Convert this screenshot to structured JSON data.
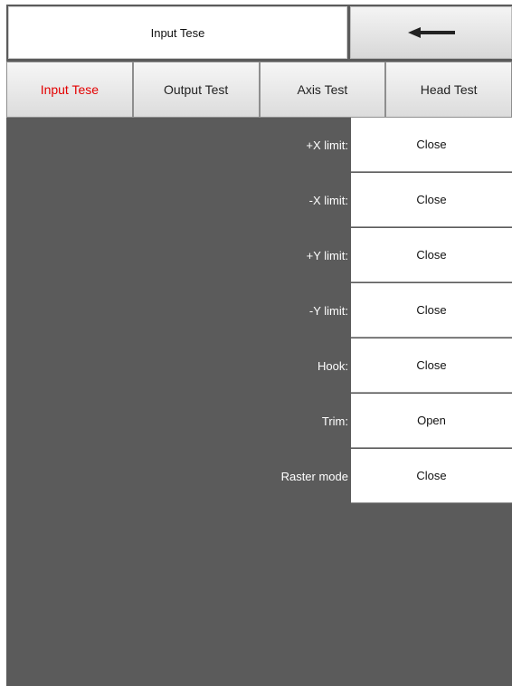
{
  "header": {
    "title": "Input Tese",
    "back_icon": "arrow-left-icon"
  },
  "tabs": [
    {
      "label": "Input Tese",
      "active": true
    },
    {
      "label": "Output Test",
      "active": false
    },
    {
      "label": "Axis Test",
      "active": false
    },
    {
      "label": "Head Test",
      "active": false
    }
  ],
  "inputs": [
    {
      "label": "+X limit:",
      "value": "Close"
    },
    {
      "label": "-X limit:",
      "value": "Close"
    },
    {
      "label": "+Y limit:",
      "value": "Close"
    },
    {
      "label": "-Y limit:",
      "value": "Close"
    },
    {
      "label": "Hook:",
      "value": "Close"
    },
    {
      "label": "Trim:",
      "value": "Open"
    },
    {
      "label": "Raster mode",
      "value": "Close"
    }
  ],
  "colors": {
    "background": "#5b5b5b",
    "active_tab_text": "#e30000"
  }
}
